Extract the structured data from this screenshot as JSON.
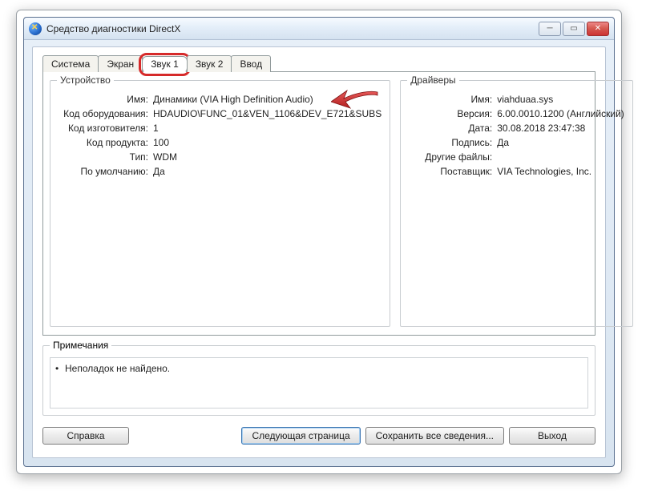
{
  "window": {
    "title": "Средство диагностики DirectX"
  },
  "tabs": {
    "system": "Система",
    "screen": "Экран",
    "sound1": "Звук 1",
    "sound2": "Звук 2",
    "input": "Ввод"
  },
  "device": {
    "legend": "Устройство",
    "labels": {
      "name": "Имя:",
      "hwid": "Код оборудования:",
      "mfgid": "Код изготовителя:",
      "prodid": "Код продукта:",
      "type": "Тип:",
      "default": "По умолчанию:"
    },
    "values": {
      "name": "Динамики (VIA High Definition Audio)",
      "hwid": "HDAUDIO\\FUNC_01&VEN_1106&DEV_E721&SUBS",
      "mfgid": "1",
      "prodid": "100",
      "type": "WDM",
      "default": "Да"
    }
  },
  "drivers": {
    "legend": "Драйверы",
    "labels": {
      "name": "Имя:",
      "version": "Версия:",
      "date": "Дата:",
      "signed": "Подпись:",
      "other": "Другие файлы:",
      "vendor": "Поставщик:"
    },
    "values": {
      "name": "viahduaa.sys",
      "version": "6.00.0010.1200 (Английский)",
      "date": "30.08.2018 23:47:38",
      "signed": "Да",
      "other": "",
      "vendor": "VIA Technologies, Inc."
    }
  },
  "notes": {
    "legend": "Примечания",
    "item": "Неполадок не найдено."
  },
  "buttons": {
    "help": "Справка",
    "next": "Следующая страница",
    "save": "Сохранить все сведения...",
    "exit": "Выход"
  }
}
